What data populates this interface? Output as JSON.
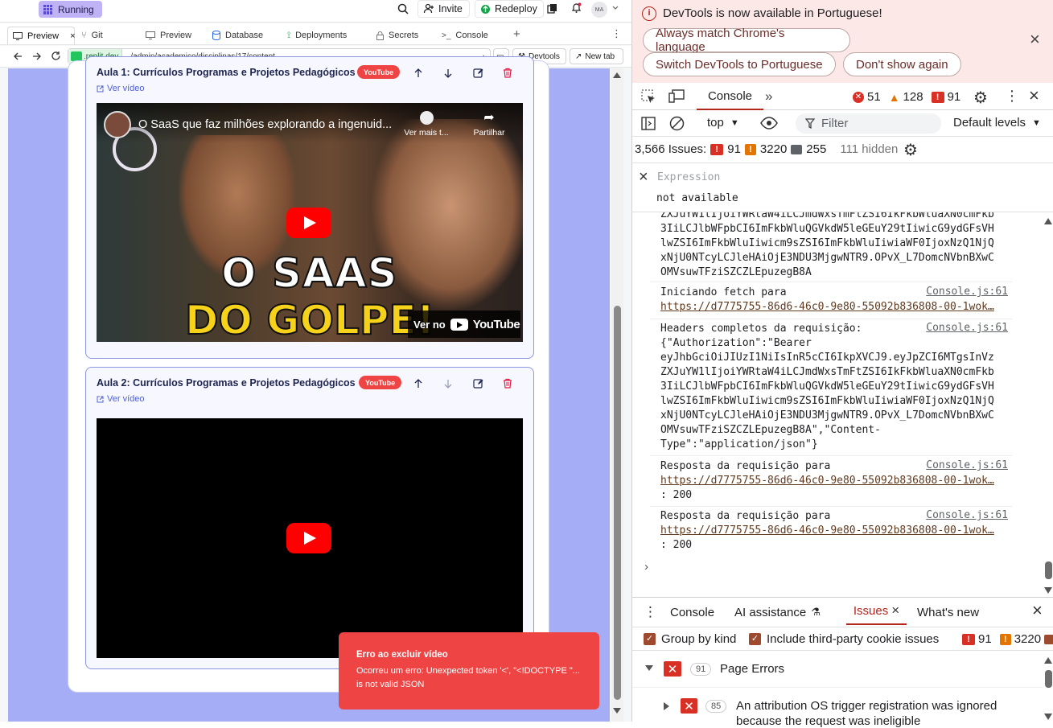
{
  "replit": {
    "status": "Running",
    "invite_label": "Invite",
    "redeploy_label": "Redeploy",
    "avatar_initials": "MA",
    "tabs": [
      "Preview",
      "Git",
      "Preview",
      "Database",
      "Deployments",
      "Secrets",
      "Console"
    ],
    "url_host": ".replit.dev",
    "url_path": "/admin/academico/disciplinas/17/content",
    "devtools_label": "Devtools",
    "newtab_label": "New tab"
  },
  "lessons": [
    {
      "title": "Aula 1: Currículos Programas e Projetos Pedagógicos",
      "badge": "YouTube",
      "link": "Ver vídeo",
      "video_title": "O SaaS que faz milhões explorando a ingenuid...",
      "watch_later": "Ver mais t...",
      "share": "Partilhar",
      "thumb_line1": "O SAAS",
      "thumb_line2": "DO GOLPE!",
      "watch_on": "Ver no",
      "yt_word": "YouTube"
    },
    {
      "title": "Aula 2: Currículos Programas e Projetos Pedagógicos",
      "badge": "YouTube",
      "link": "Ver vídeo"
    }
  ],
  "toast": {
    "title": "Erro ao excluir vídeo",
    "message": "Ocorreu um erro: Unexpected token '<', \"<!DOCTYPE \"... is not valid JSON"
  },
  "devtools": {
    "info_title": "DevTools is now available in Portuguese!",
    "btn_match": "Always match Chrome's language",
    "btn_switch": "Switch DevTools to Portuguese",
    "btn_dont": "Don't show again",
    "tab_console": "Console",
    "errors": "51",
    "warnings": "128",
    "issues_count": "91",
    "context": "top",
    "filter_placeholder": "Filter",
    "levels": "Default levels",
    "issues_total": "3,566 Issues:",
    "issues_red": "91",
    "issues_orange": "3220",
    "issues_info": "255",
    "hidden": "111 hidden",
    "expression_label": "Expression",
    "expression_value": "not available",
    "log": [
      {
        "text": "ZXJuYW1lIjoiYWRtaW4iLCJmdWxsTmFtZSI6IkFkbWluaXN0cmFkb\n3IiLCJlbWFpbCI6ImFkbWluQGVkdW5leGEuY29tIiwicG9ydGFsVH\nlwZSI6ImFkbWluIiwicm9sZSI6ImFkbWluIiwiaWF0IjoxNzQ1NjQ\nxNjU0NTcyLCJleHAiOjE3NDU3MjgwNTR9.OPvX_L7DomcNVbnBXwC\nOMVsuwTFziSZCZLEpuzegB8A",
        "source": ""
      },
      {
        "text": "Iniciando fetch para",
        "link": "https://d7775755-86d6-46c0-9e80-55092b836808-00-1wok…",
        "source": "Console.js:61"
      },
      {
        "text": "Headers completos da requisição:\n{\"Authorization\":\"Bearer\neyJhbGciOiJIUzI1NiIsInR5cCI6IkpXVCJ9.eyJpZCI6MTgsInVz\nZXJuYW1lIjoiYWRtaW4iLCJmdWxsTmFtZSI6IkFkbWluaXN0cmFkb\n3IiLCJlbWFpbCI6ImFkbWluQGVkdW5leGEuY29tIiwicG9ydGFsVH\nlwZSI6ImFkbWluIiwicm9sZSI6ImFkbWluIiwiaWF0IjoxNzQ1NjQ\nxNjU0NTcyLCJleHAiOjE3NDU3MjgwNTR9.OPvX_L7DomcNVbnBXwC\nOMVsuwTFziSZCZLEpuzegB8A\",\"Content-\nType\":\"application/json\"}",
        "source": "Console.js:61"
      },
      {
        "text": "Resposta da requisição para",
        "link": "https://d7775755-86d6-46c0-9e80-55092b836808-00-1wok…",
        "tail": ": 200",
        "source": "Console.js:61"
      },
      {
        "text": "Resposta da requisição para",
        "link": "https://d7775755-86d6-46c0-9e80-55092b836808-00-1wok…",
        "tail": ": 200",
        "source": "Console.js:61"
      }
    ],
    "drawer": {
      "tabs": [
        "Console",
        "AI assistance",
        "Issues",
        "What's new"
      ],
      "group_by_kind": "Group by kind",
      "include_third_party": "Include third-party cookie issues",
      "red_count": "91",
      "orange_count": "3220",
      "page_errors_count": "91",
      "page_errors": "Page Errors",
      "issue_count": "85",
      "issue_text": "An attribution OS trigger registration was ignored",
      "issue_text2": "because the request was ineligible"
    }
  }
}
